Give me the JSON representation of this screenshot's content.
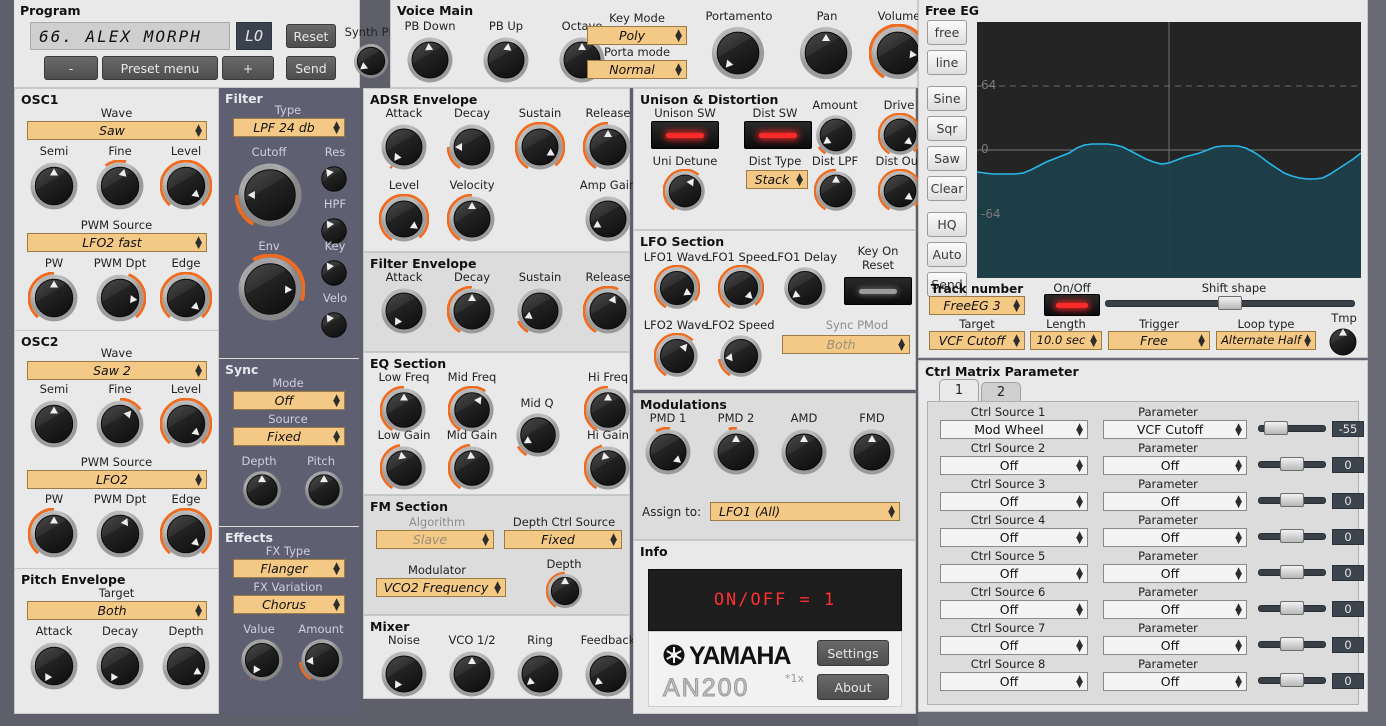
{
  "program": {
    "title": "Program",
    "display_value": "66. ALEX MORPH",
    "display_badge": "LO",
    "reset_label": "Reset",
    "send_label": "Send",
    "minus_label": "-",
    "plus_label": "+",
    "preset_menu_label": "Preset menu",
    "synth_prg_label": "Synth PRG"
  },
  "voice_main": {
    "title": "Voice Main",
    "knobs": [
      {
        "label": "PB Down",
        "angle": -5,
        "arc": false
      },
      {
        "label": "PB Up",
        "angle": 8,
        "arc": false
      },
      {
        "label": "Octave",
        "angle": 0,
        "arc": false
      }
    ],
    "key_mode_label": "Key Mode",
    "key_mode_value": "Poly",
    "porta_mode_label": "Porta mode",
    "porta_mode_value": "Normal",
    "portamento_label": "Portamento",
    "portamento_angle": -140,
    "pan_label": "Pan",
    "pan_angle": 0,
    "volume_label": "Volume",
    "volume_angle": 96
  },
  "osc1": {
    "title": "OSC1",
    "wave_label": "Wave",
    "wave_value": "Saw",
    "pwm_source_label": "PWM Source",
    "pwm_source_value": "LFO2 fast",
    "knobs_row1": [
      {
        "label": "Semi",
        "angle": 0,
        "arc": false
      },
      {
        "label": "Fine",
        "angle": 14,
        "arc": true,
        "arcstart": -35,
        "arcend": 14
      },
      {
        "label": "Level",
        "angle": 130,
        "arc": true,
        "arcstart": -140,
        "arcend": 140
      }
    ],
    "knobs_row2": [
      {
        "label": "PW",
        "angle": 0,
        "arc": true,
        "arcstart": -140,
        "arcend": 0
      },
      {
        "label": "PWM Dpt",
        "angle": 96,
        "arc": true,
        "arcstart": 20,
        "arcend": 140
      },
      {
        "label": "Edge",
        "angle": 132,
        "arc": true,
        "arcstart": -140,
        "arcend": 140
      }
    ]
  },
  "osc2": {
    "title": "OSC2",
    "wave_label": "Wave",
    "wave_value": "Saw 2",
    "pwm_source_label": "PWM Source",
    "pwm_source_value": "LFO2",
    "knobs_row1": [
      {
        "label": "Semi",
        "angle": 0,
        "arc": false
      },
      {
        "label": "Fine",
        "angle": 40,
        "arc": true,
        "arcstart": 0,
        "arcend": 55
      },
      {
        "label": "Level",
        "angle": 130,
        "arc": true,
        "arcstart": -140,
        "arcend": 140
      }
    ],
    "knobs_row2": [
      {
        "label": "PW",
        "angle": 0,
        "arc": true,
        "arcstart": -140,
        "arcend": 0
      },
      {
        "label": "PWM Dpt",
        "angle": 25,
        "arc": false
      },
      {
        "label": "Edge",
        "angle": 132,
        "arc": true,
        "arcstart": -140,
        "arcend": 140
      }
    ]
  },
  "pitch_envelope": {
    "title": "Pitch Envelope",
    "target_label": "Target",
    "target_value": "Both",
    "knobs": [
      {
        "label": "Attack",
        "angle": -150,
        "arc": false
      },
      {
        "label": "Decay",
        "angle": -150,
        "arc": false
      },
      {
        "label": "Depth",
        "angle": 118,
        "arc": false
      }
    ]
  },
  "filter": {
    "title": "Filter",
    "type_label": "Type",
    "type_value": "LPF 24 db",
    "cutoff_label": "Cutoff",
    "cutoff_angle": -90,
    "res_label": "Res",
    "res_angle": -38,
    "hpf_label": "HPF",
    "hpf_angle": -35,
    "env_label": "Env",
    "env_angle": 92,
    "key_label": "Key",
    "key_angle": -35,
    "velo_label": "Velo",
    "velo_angle": -35
  },
  "sync": {
    "title": "Sync",
    "mode_label": "Mode",
    "mode_value": "Off",
    "source_label": "Source",
    "source_value": "Fixed",
    "depth_label": "Depth",
    "depth_angle": 0,
    "pitch_label": "Pitch",
    "pitch_angle": 0
  },
  "effects": {
    "title": "Effects",
    "fx_type_label": "FX Type",
    "fx_type_value": "Flanger",
    "fx_variation_label": "FX Variation",
    "fx_variation_value": "Chorus",
    "value_label": "Value",
    "value_angle": -148,
    "amount_label": "Amount",
    "amount_angle": -95
  },
  "adsr": {
    "title": "ADSR Envelope",
    "row1": [
      {
        "label": "Attack",
        "angle": -145,
        "arc": true,
        "arcstart": -150,
        "arcend": -145
      },
      {
        "label": "Decay",
        "angle": -90,
        "arc": true,
        "arcstart": -150,
        "arcend": -90
      },
      {
        "label": "Sustain",
        "angle": 120,
        "arc": true,
        "arcstart": -150,
        "arcend": 140
      },
      {
        "label": "Release",
        "angle": 0,
        "arc": true,
        "arcstart": -150,
        "arcend": 0
      }
    ],
    "row2": [
      {
        "label": "Level",
        "angle": 125,
        "arc": true,
        "arcstart": -150,
        "arcend": 140
      },
      {
        "label": "Velocity",
        "angle": 0,
        "arc": true,
        "arcstart": -150,
        "arcend": 0
      },
      {
        "label": "Amp Gain",
        "angle": -120,
        "arc": false
      }
    ]
  },
  "filter_env": {
    "title": "Filter Envelope",
    "knobs": [
      {
        "label": "Attack",
        "angle": -148,
        "arc": false
      },
      {
        "label": "Decay",
        "angle": 0,
        "arc": true,
        "arcstart": -150,
        "arcend": 0
      },
      {
        "label": "Sustain",
        "angle": -115,
        "arc": true,
        "arcstart": -150,
        "arcend": -115
      },
      {
        "label": "Release",
        "angle": 25,
        "arc": true,
        "arcstart": -150,
        "arcend": 25
      }
    ]
  },
  "eq": {
    "title": "EQ Section",
    "row1": [
      {
        "label": "Low Freq",
        "angle": 0,
        "arc": true,
        "arcstart": -150,
        "arcend": 0
      },
      {
        "label": "Mid Freq",
        "angle": 35,
        "arc": true,
        "arcstart": -150,
        "arcend": 35
      },
      {
        "label": "Hi Freq",
        "angle": 0,
        "arc": true,
        "arcstart": -150,
        "arcend": 0
      }
    ],
    "mid_q_label": "Mid Q",
    "mid_q_angle": -120,
    "row2": [
      {
        "label": "Low Gain",
        "angle": -10,
        "arc": true,
        "arcstart": -150,
        "arcend": -10
      },
      {
        "label": "Mid Gain",
        "angle": -5,
        "arc": true,
        "arcstart": -150,
        "arcend": -5
      },
      {
        "label": "Hi Gain",
        "angle": -15,
        "arc": true,
        "arcstart": -150,
        "arcend": -15
      }
    ]
  },
  "fm": {
    "title": "FM Section",
    "algorithm_label": "Algorithm",
    "algorithm_value": "Slave",
    "depth_ctrl_source_label": "Depth Ctrl Source",
    "depth_ctrl_source_value": "Fixed",
    "modulator_label": "Modulator",
    "modulator_value": "VCO2 Frequency",
    "depth_label": "Depth",
    "depth_angle": 0
  },
  "mixer": {
    "title": "Mixer",
    "knobs": [
      {
        "label": "Noise",
        "angle": -148,
        "arc": false
      },
      {
        "label": "VCO 1/2",
        "angle": 0,
        "arc": false
      },
      {
        "label": "Ring",
        "angle": -130,
        "arc": false
      },
      {
        "label": "Feedback",
        "angle": -130,
        "arc": false
      }
    ]
  },
  "unison": {
    "title": "Unison & Distortion",
    "unison_sw_label": "Unison SW",
    "unison_sw_on": true,
    "dist_sw_label": "Dist SW",
    "dist_sw_on": true,
    "amount_label": "Amount",
    "amount_angle": -125,
    "drive_label": "Drive",
    "drive_angle": 128,
    "uni_detune_label": "Uni Detune",
    "uni_detune_angle": 35,
    "dist_type_label": "Dist Type",
    "dist_type_value": "Stack",
    "dist_lpf_label": "Dist LPF",
    "dist_lpf_angle": 0,
    "dist_out_label": "Dist Out",
    "dist_out_angle": 125
  },
  "lfo": {
    "title": "LFO Section",
    "lfo1_wave_label": "LFO1 Wave",
    "lfo1_wave_angle": 115,
    "lfo1_speed_label": "LFO1 Speed",
    "lfo1_speed_angle": 133,
    "lfo1_delay_label": "LFO1 Delay",
    "lfo1_delay_angle": -128,
    "key_on_reset_label": "Key On\nReset",
    "key_on_reset_line1": "Key On",
    "key_on_reset_line2": "Reset",
    "key_on_reset_on": false,
    "lfo2_wave_label": "LFO2 Wave",
    "lfo2_wave_angle": 40,
    "lfo2_speed_label": "LFO2 Speed",
    "lfo2_speed_angle": -98,
    "sync_pmod_label": "Sync PMod",
    "sync_pmod_value": "Both"
  },
  "modulations": {
    "title": "Modulations",
    "knobs": [
      {
        "label": "PMD 1",
        "angle": 130,
        "arc": true,
        "arcstart": -30,
        "arcend": 5
      },
      {
        "label": "PMD 2",
        "angle": 0,
        "arc": true,
        "arcstart": -18,
        "arcend": 2
      },
      {
        "label": "AMD",
        "angle": 0,
        "arc": false
      },
      {
        "label": "FMD",
        "angle": 0,
        "arc": false
      }
    ],
    "assign_to_label": "Assign to:",
    "assign_to_value": "LFO1 (All)"
  },
  "info": {
    "title": "Info",
    "display_text": "ON/OFF = 1",
    "brand": "YAMAHA",
    "model": "AN200",
    "model_sup": "*1x",
    "settings_label": "Settings",
    "about_label": "About"
  },
  "free_eg": {
    "title": "Free EG",
    "side_buttons": [
      "free",
      "line",
      "Sine",
      "Sqr",
      "Saw",
      "Clear",
      "HQ",
      "Auto",
      "Send"
    ],
    "axis_labels": {
      "top": "64",
      "mid": "0",
      "bottom": "-64"
    },
    "track_number_label": "Track number",
    "track_number_value": "FreeEG 3",
    "onoff_label": "On/Off",
    "onoff_on": true,
    "shift_shape_label": "Shift shape",
    "shift_shape_pos": 50,
    "target_label": "Target",
    "target_value": "VCF Cutoff",
    "length_label": "Length",
    "length_value": "10.0 sec",
    "trigger_label": "Trigger",
    "trigger_value": "Free",
    "loop_type_label": "Loop type",
    "loop_type_value": "Alternate Half",
    "tmp_label": "Tmp",
    "tmp_angle": 0
  },
  "chart_data": {
    "type": "line",
    "title": "Free EG",
    "xlabel": "",
    "ylabel": "",
    "ylim": [
      -128,
      128
    ],
    "ytick_labels": [
      "64",
      "0",
      "-64"
    ],
    "ytick_values": [
      64,
      0,
      -64
    ],
    "grid": true,
    "legend": "none",
    "series": [
      {
        "name": "FreeEG 3",
        "color": "#29b6e8",
        "x": [
          0,
          2,
          4,
          6,
          8,
          10,
          12,
          14,
          16,
          18,
          20,
          22,
          24,
          26,
          28,
          30,
          32,
          34,
          36,
          38,
          40,
          42,
          44,
          46,
          48,
          50,
          52,
          54,
          56,
          58,
          60,
          62,
          64,
          66,
          68,
          70,
          72,
          74,
          76,
          78,
          80,
          82,
          84,
          86,
          88,
          90,
          92,
          94,
          96,
          98,
          100
        ],
        "y": [
          -22,
          -23,
          -24,
          -24,
          -24,
          -24,
          -23,
          -20,
          -16,
          -12,
          -9,
          -6,
          -3,
          2,
          5,
          6,
          6,
          6,
          5,
          3,
          -1,
          -5,
          -9,
          -12,
          -14,
          -13,
          -10,
          -7,
          -5,
          -3,
          0,
          3,
          4,
          4,
          4,
          2,
          -2,
          -7,
          -13,
          -18,
          -23,
          -26,
          -28,
          -29,
          -29,
          -28,
          -24,
          -19,
          -14,
          -9,
          -3
        ]
      }
    ]
  },
  "ctrl_matrix": {
    "title": "Ctrl Matrix Parameter",
    "tabs": [
      "1",
      "2"
    ],
    "active_tab": "1",
    "source_col_label": "Ctrl Source",
    "param_col_label": "Parameter",
    "rows": [
      {
        "source_label": "Ctrl Source 1",
        "source_value": "Mod Wheel",
        "param_label": "Parameter",
        "param_value": "VCF Cutoff",
        "slider_pos": 14,
        "value": "-55"
      },
      {
        "source_label": "Ctrl Source 2",
        "source_value": "Off",
        "param_label": "Parameter",
        "param_value": "Off",
        "slider_pos": 50,
        "value": "0"
      },
      {
        "source_label": "Ctrl Source 3",
        "source_value": "Off",
        "param_label": "Parameter",
        "param_value": "Off",
        "slider_pos": 50,
        "value": "0"
      },
      {
        "source_label": "Ctrl Source 4",
        "source_value": "Off",
        "param_label": "Parameter",
        "param_value": "Off",
        "slider_pos": 50,
        "value": "0"
      },
      {
        "source_label": "Ctrl Source 5",
        "source_value": "Off",
        "param_label": "Parameter",
        "param_value": "Off",
        "slider_pos": 50,
        "value": "0"
      },
      {
        "source_label": "Ctrl Source 6",
        "source_value": "Off",
        "param_label": "Parameter",
        "param_value": "Off",
        "slider_pos": 50,
        "value": "0"
      },
      {
        "source_label": "Ctrl Source 7",
        "source_value": "Off",
        "param_label": "Parameter",
        "param_value": "Off",
        "slider_pos": 50,
        "value": "0"
      },
      {
        "source_label": "Ctrl Source 8",
        "source_value": "Off",
        "param_label": "Parameter",
        "param_value": "Off",
        "slider_pos": 50,
        "value": "0"
      }
    ]
  },
  "colors": {
    "accent_amber": "#f4c885",
    "accent_orange": "#ef6b1f",
    "eg_line": "#29b6e8",
    "panel_light": "#e9e9e9",
    "panel_dark": "#5f5f72",
    "led_red": "#ff2b2b"
  }
}
